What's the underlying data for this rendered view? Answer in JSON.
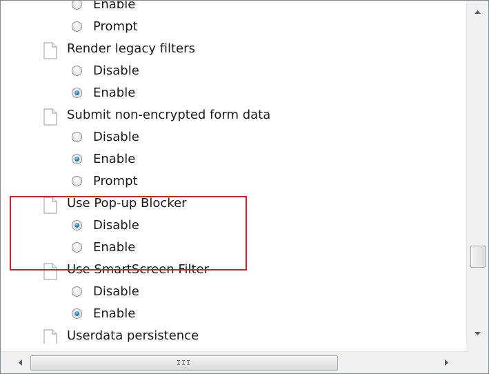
{
  "policy_tree": [
    {
      "kind": "option",
      "label": "Enable",
      "checked": false
    },
    {
      "kind": "option",
      "label": "Prompt",
      "checked": false
    },
    {
      "kind": "setting",
      "label": "Render legacy filters",
      "icon": "document-icon"
    },
    {
      "kind": "option",
      "label": "Disable",
      "checked": false
    },
    {
      "kind": "option",
      "label": "Enable",
      "checked": true
    },
    {
      "kind": "setting",
      "label": "Submit non-encrypted form data",
      "icon": "document-icon"
    },
    {
      "kind": "option",
      "label": "Disable",
      "checked": false
    },
    {
      "kind": "option",
      "label": "Enable",
      "checked": true
    },
    {
      "kind": "option",
      "label": "Prompt",
      "checked": false
    },
    {
      "kind": "setting",
      "label": "Use Pop-up Blocker",
      "icon": "document-icon"
    },
    {
      "kind": "option",
      "label": "Disable",
      "checked": true
    },
    {
      "kind": "option",
      "label": "Enable",
      "checked": false
    },
    {
      "kind": "setting",
      "label": "Use SmartScreen Filter",
      "icon": "document-icon"
    },
    {
      "kind": "option",
      "label": "Disable",
      "checked": false
    },
    {
      "kind": "option",
      "label": "Enable",
      "checked": true
    },
    {
      "kind": "setting",
      "label": "Userdata persistence",
      "icon": "document-icon"
    }
  ],
  "highlight_color": "#d11f26",
  "radio_selected_color": "#1d74b8",
  "scrollbar": {
    "vertical_position": 0.72,
    "horizontal_grip": "III"
  }
}
